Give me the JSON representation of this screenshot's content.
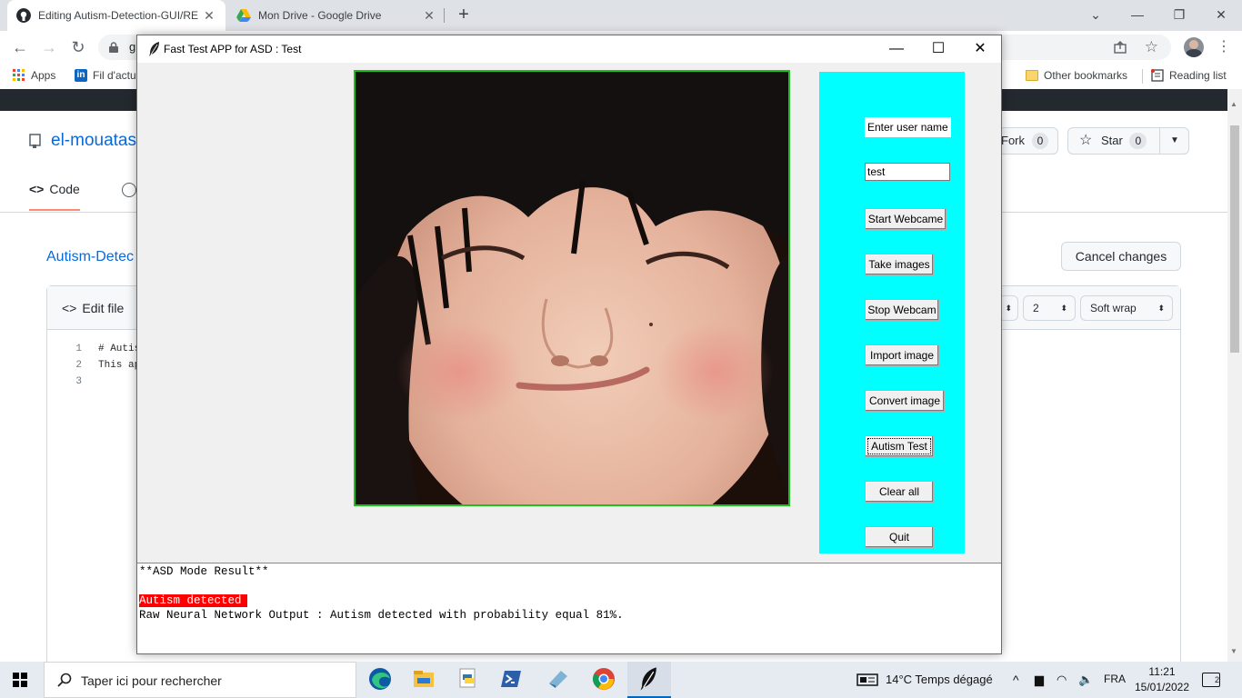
{
  "browser": {
    "tabs": [
      {
        "title": "Editing Autism-Detection-GUI/RE",
        "active": true
      },
      {
        "title": "Mon Drive - Google Drive",
        "active": false
      }
    ],
    "new_tab": "+",
    "window_controls": {
      "minimize": "⌄",
      "minimize2": "—",
      "restore": "❐",
      "close": "✕"
    },
    "address": "g",
    "bookmarks": [
      {
        "label": "Apps"
      },
      {
        "label": "Fil d'actu"
      }
    ],
    "other_bookmarks": "Other bookmarks",
    "reading_list": "Reading list"
  },
  "github": {
    "repo_owner": "el-mouatas",
    "code_tab": "Code",
    "file_path": "Autism-Detec",
    "fork_label": "Fork",
    "fork_count": "0",
    "star_label": "Star",
    "star_count": "0",
    "cancel_changes": "Cancel changes",
    "edit_file_tab": "Edit file",
    "indent_size": "2",
    "wrap_mode": "Soft wrap",
    "code_lines": [
      {
        "num": "1",
        "text": "# Autis"
      },
      {
        "num": "2",
        "text": "This ap"
      },
      {
        "num": "3",
        "text": ""
      }
    ]
  },
  "app": {
    "title": "Fast Test APP for ASD :  Test",
    "window_controls": {
      "minimize": "—",
      "maximize": "☐",
      "close": "✕"
    },
    "panel": {
      "user_label": "Enter user name",
      "user_value": "test",
      "buttons": {
        "start_webcam": "Start Webcame",
        "take_images": "Take images",
        "stop_webcam": "Stop Webcam",
        "import_image": "Import image",
        "convert_image": "Convert image",
        "autism_test": "Autism Test",
        "clear_all": "Clear all",
        "quit": "Quit"
      }
    },
    "console": {
      "header": "**ASD Mode Result**",
      "result": "Autism detected",
      "detail": "Raw Neural Network Output : Autism detected with probability equal 81%."
    },
    "colors": {
      "panel": "#00ffff",
      "frame": "#1fbf1f",
      "result_bg": "#ff0000"
    }
  },
  "taskbar": {
    "search_placeholder": "Taper ici pour rechercher",
    "weather": "14°C  Temps dégagé",
    "language": "FRA",
    "time": "11:21",
    "date": "15/01/2022",
    "notifications": "2",
    "icons": [
      "edge-icon",
      "file-explorer-icon",
      "python-icon",
      "powershell-icon",
      "app-icon",
      "chrome-icon",
      "tk-feather-icon"
    ]
  }
}
